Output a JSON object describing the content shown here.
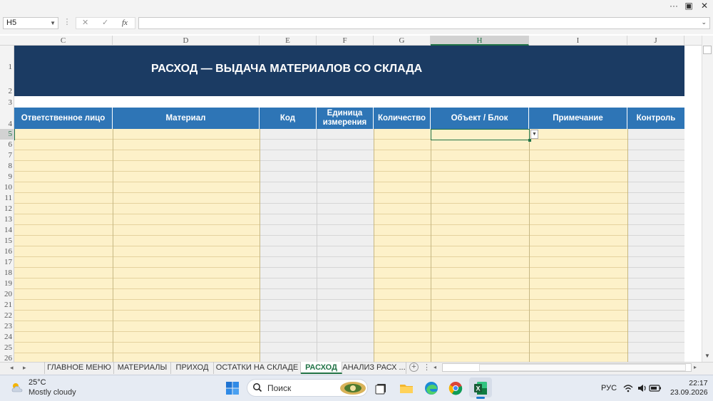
{
  "window": {
    "controls": [
      "···",
      "▣",
      "✕"
    ]
  },
  "formula_bar": {
    "name_box": "H5",
    "cancel_glyph": "✕",
    "enter_glyph": "✓",
    "fx_label": "fx",
    "formula_value": ""
  },
  "columns": [
    {
      "id": "C",
      "label": "C"
    },
    {
      "id": "D",
      "label": "D"
    },
    {
      "id": "E",
      "label": "E"
    },
    {
      "id": "F",
      "label": "F"
    },
    {
      "id": "G",
      "label": "G"
    },
    {
      "id": "H",
      "label": "H",
      "selected": true
    },
    {
      "id": "I",
      "label": "I"
    },
    {
      "id": "J",
      "label": "J"
    }
  ],
  "rows": [
    "1",
    "2",
    "3",
    "4",
    "5",
    "6",
    "7",
    "8",
    "9",
    "10",
    "11",
    "12",
    "13",
    "14",
    "15",
    "16",
    "17",
    "18",
    "19",
    "20",
    "21",
    "22",
    "23",
    "24",
    "25",
    "26"
  ],
  "selected_row": "5",
  "sheet": {
    "title": "РАСХОД — ВЫДАЧА МАТЕРИАЛОВ СО СКЛАДА",
    "headers": [
      "Ответственное лицо",
      "Материал",
      "Код",
      "Единица измерения",
      "Количество",
      "Объект / Блок",
      "Примечание",
      "Контроль"
    ],
    "colors": {
      "title_band": "#1b3b63",
      "header_band": "#2e75b6",
      "input_fill": "#fdf1c9",
      "calc_fill": "#efefef",
      "excel_green": "#217346"
    }
  },
  "tabs": {
    "nav_glyph": "▸",
    "items": [
      {
        "label": "ГЛАВНОЕ МЕНЮ",
        "active": false
      },
      {
        "label": "МАТЕРИАЛЫ",
        "active": false
      },
      {
        "label": "ПРИХОД",
        "active": false
      },
      {
        "label": "ОСТАТКИ НА СКЛАДЕ",
        "active": false
      },
      {
        "label": "РАСХОД",
        "active": true
      },
      {
        "label": "АНАЛИЗ РАСХ ...",
        "active": false
      }
    ],
    "add_glyph": "+",
    "more_glyph": "⋮"
  },
  "taskbar": {
    "temperature": "25°C",
    "weather": "Mostly cloudy",
    "search_placeholder": "Поиск",
    "apps": [
      "file-explorer-icon",
      "edge-icon",
      "chrome-icon",
      "excel-icon"
    ],
    "language": "РУС",
    "time": "22:17",
    "date": "23.09.2026"
  }
}
